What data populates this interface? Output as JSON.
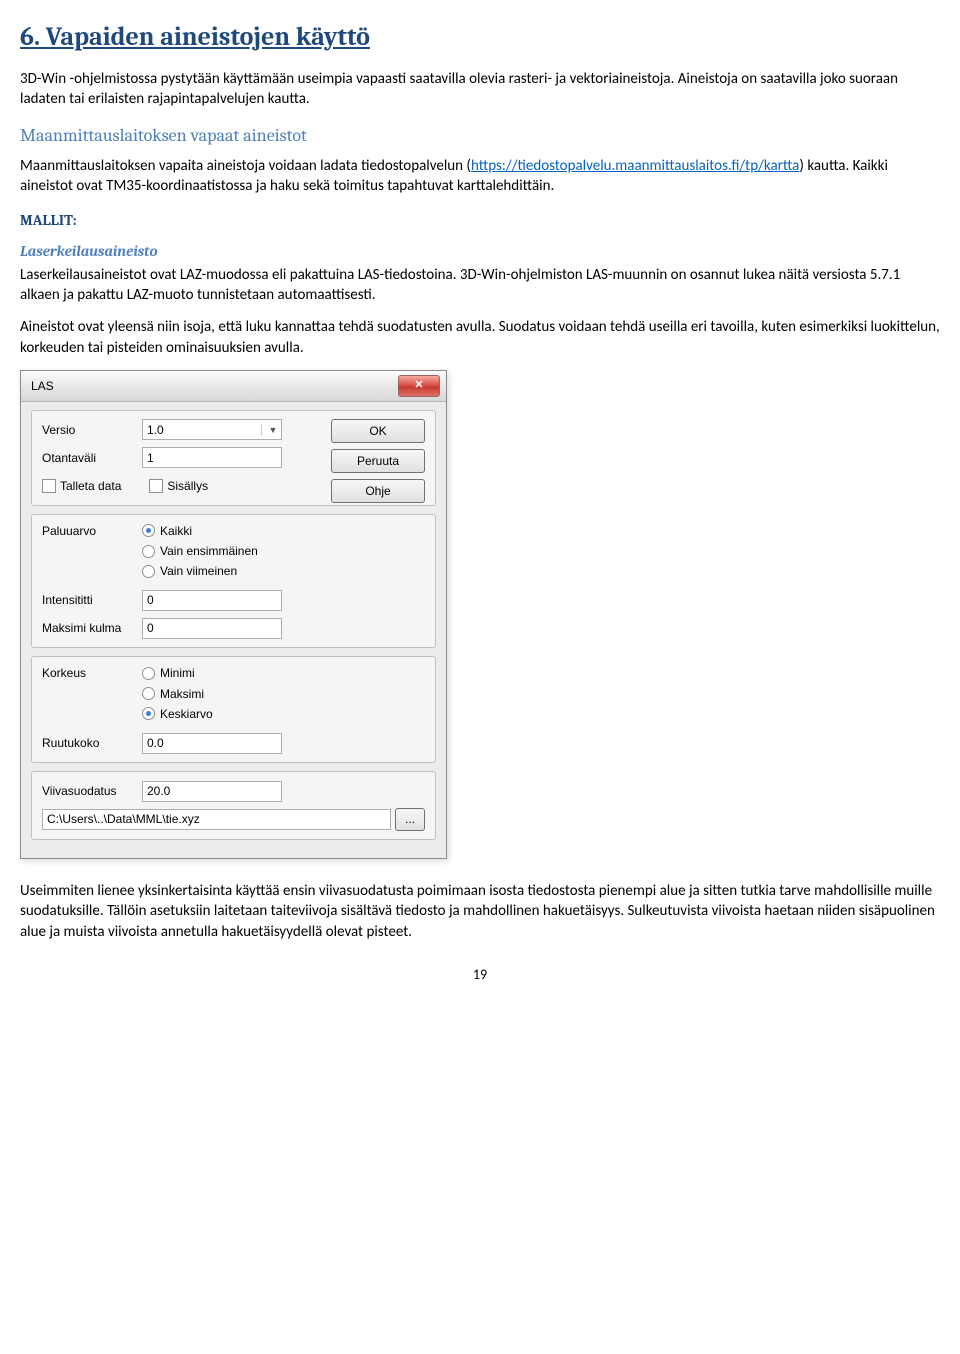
{
  "heading": "6. Vapaiden aineistojen käyttö",
  "p1": "3D-Win -ohjelmistossa pystytään käyttämään useimpia vapaasti saatavilla olevia rasteri- ja vektoriaineistoja. Aineistoja on saatavilla joko suoraan ladaten tai erilaisten rajapintapalvelujen kautta.",
  "sub1": "Maanmittauslaitoksen vapaat aineistot",
  "p2a": "Maanmittauslaitoksen vapaita aineistoja voidaan ladata tiedostopalvelun (",
  "link": "https://tiedostopalvelu.maanmittauslaitos.fi/tp/kartta",
  "p2b": ")  kautta. Kaikki aineistot ovat TM35-koordinaatistossa ja haku sekä toimitus tapahtuvat karttalehdittäin.",
  "mallit": "MALLIT:",
  "sub2": "Laserkeilausaineisto",
  "p3": "Laserkeilausaineistot ovat LAZ-muodossa eli pakattuina LAS-tiedostoina. 3D-Win-ohjelmiston LAS-muunnin on osannut lukea näitä versiosta 5.7.1 alkaen ja pakattu LAZ-muoto tunnistetaan automaattisesti.",
  "p4": "Aineistot ovat yleensä niin isoja, että luku kannattaa tehdä suodatusten avulla. Suodatus voidaan tehdä useilla eri tavoilla, kuten esimerkiksi luokittelun, korkeuden tai  pisteiden ominaisuuksien avulla.",
  "p5": "Useimmiten lienee yksinkertaisinta käyttää ensin viivasuodatusta poimimaan isosta tiedostosta pienempi alue ja sitten tutkia tarve mahdollisille muille suodatuksille. Tällöin asetuksiin laitetaan taiteviivoja sisältävä tiedosto ja mahdollinen hakuetäisyys. Sulkeutuvista viivoista haetaan niiden sisäpuolinen alue ja muista viivoista annetulla hakuetäisyydellä olevat pisteet.",
  "pagenum": "19",
  "dialog": {
    "title": "LAS",
    "close": "✕",
    "buttons": {
      "ok": "OK",
      "cancel": "Peruuta",
      "help": "Ohje"
    },
    "versio_label": "Versio",
    "versio_value": "1.0",
    "otantavali_label": "Otantaväli",
    "otantavali_value": "1",
    "talleta_data": "Talleta data",
    "sisallys": "Sisällys",
    "paluuarvo_label": "Paluuarvo",
    "paluuarvo_options": [
      "Kaikki",
      "Vain ensimmäinen",
      "Vain viimeinen"
    ],
    "intensititti_label": "Intensititti",
    "intensititti_value": "0",
    "maksimi_kulma_label": "Maksimi kulma",
    "maksimi_kulma_value": "0",
    "korkeus_label": "Korkeus",
    "korkeus_options": [
      "Minimi",
      "Maksimi",
      "Keskiarvo"
    ],
    "ruutukoko_label": "Ruutukoko",
    "ruutukoko_value": "0.0",
    "viivasuodatus_label": "Viivasuodatus",
    "viivasuodatus_value": "20.0",
    "path": "C:\\Users\\..\\Data\\MML\\tie.xyz",
    "browse": "..."
  }
}
